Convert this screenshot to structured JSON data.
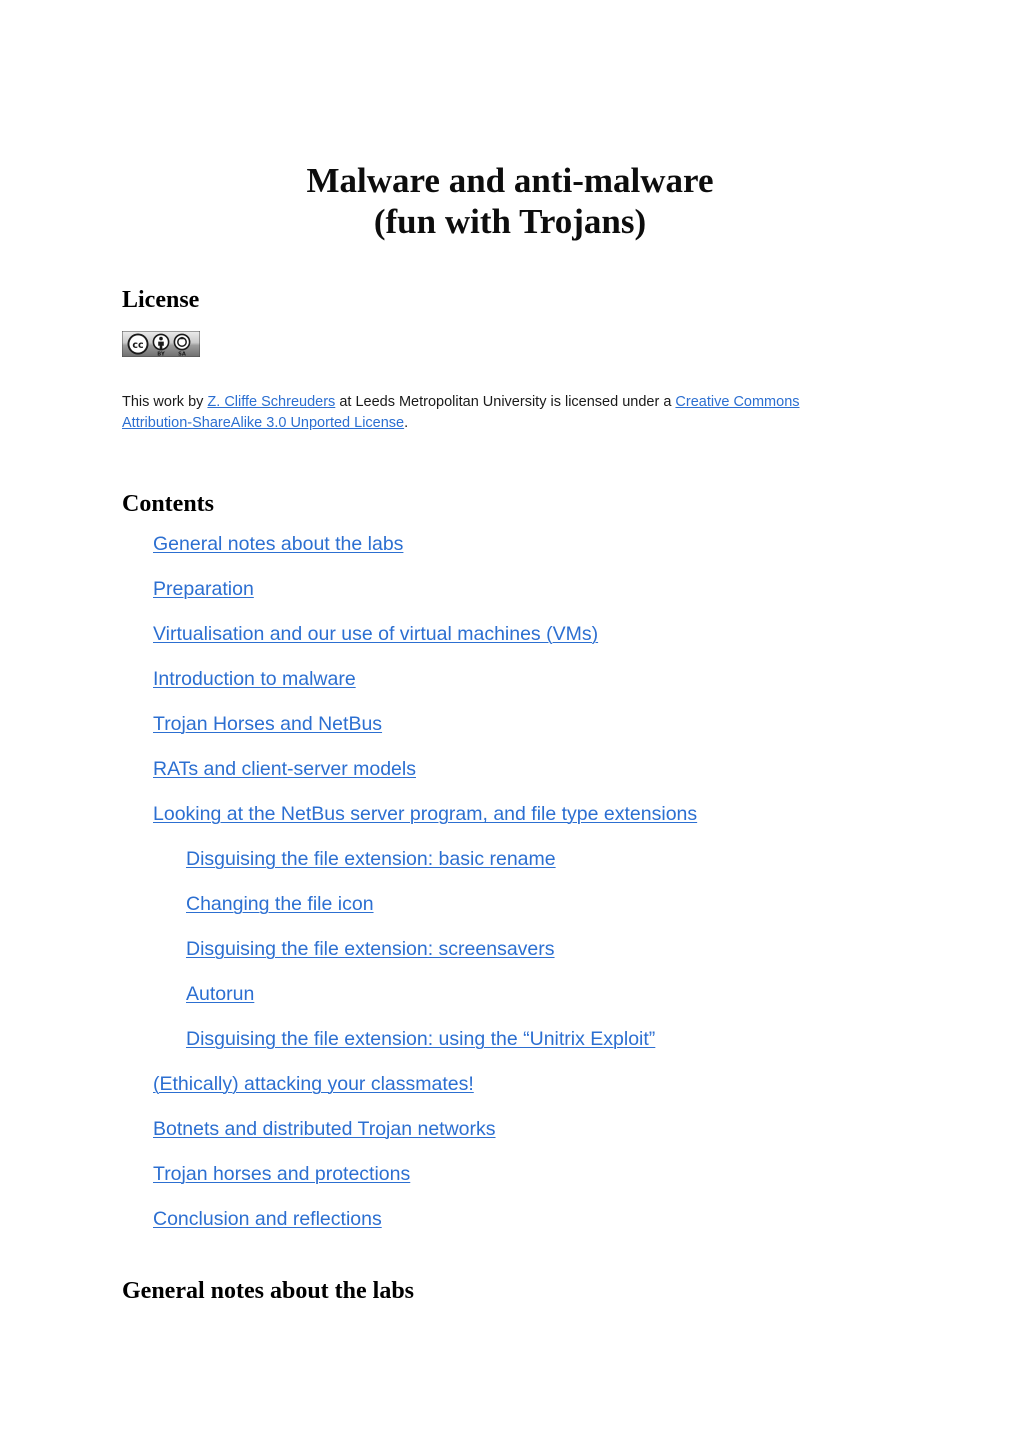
{
  "document": {
    "title_lines": [
      "Malware and anti-malware",
      "(fun with Trojans)"
    ],
    "link_color": "#2c6fd1",
    "text_color": "#000000",
    "background_color": "#ffffff"
  },
  "license": {
    "heading": "License",
    "badge": {
      "icon_name": "creative-commons-by-sa-badge",
      "cc_label": "CC",
      "by_label": "BY",
      "sa_label": "SA"
    },
    "text_before_author": "This work by ",
    "author_link": "Z. Cliffe Schreuders",
    "text_middle": " at Leeds Metropolitan University is licensed under a ",
    "license_link": "Creative Commons Attribution-ShareAlike 3.0 Unported License",
    "text_after": "."
  },
  "contents": {
    "heading": "Contents",
    "items": [
      {
        "label": "General notes about the labs",
        "level": 1
      },
      {
        "label": "Preparation",
        "level": 1
      },
      {
        "label": "Virtualisation and our use of virtual machines (VMs)",
        "level": 1
      },
      {
        "label": "Introduction to malware",
        "level": 1
      },
      {
        "label": "Trojan Horses and NetBus",
        "level": 1
      },
      {
        "label": "RATs and client-server models",
        "level": 1
      },
      {
        "label": "Looking at the NetBus server program, and file type extensions",
        "level": 1
      },
      {
        "label": "Disguising the file extension: basic rename",
        "level": 2
      },
      {
        "label": "Changing the file icon",
        "level": 2
      },
      {
        "label": "Disguising the file extension: screensavers",
        "level": 2
      },
      {
        "label": "Autorun",
        "level": 2
      },
      {
        "label": "Disguising the file extension: using the “Unitrix Exploit”",
        "level": 2
      },
      {
        "label": "(Ethically) attacking your classmates!",
        "level": 1
      },
      {
        "label": "Botnets and distributed Trojan networks",
        "level": 1
      },
      {
        "label": "Trojan horses and protections",
        "level": 1
      },
      {
        "label": "Conclusion and reflections",
        "level": 1
      }
    ]
  },
  "sections": {
    "general_notes_heading": "General notes about the labs"
  }
}
